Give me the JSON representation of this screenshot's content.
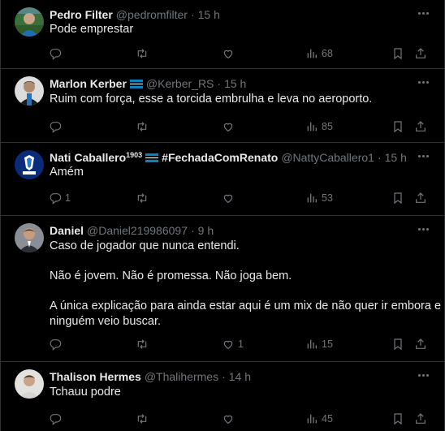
{
  "tweets": [
    {
      "name": "Pedro Filter",
      "name_sup": "",
      "hashtag": "",
      "handle": "@pedromfilter",
      "time": "15 h",
      "text": [
        "Pode emprestar"
      ],
      "replies": "",
      "retweets": "",
      "likes": "",
      "views": "68",
      "avatar": "pedro-avatar"
    },
    {
      "name": "Marlon Kerber",
      "name_sup": "",
      "hashtag": "",
      "handle": "@Kerber_RS",
      "time": "15 h",
      "text": [
        "Ruim com força, esse a torcida embrulha e leva no aeroporto."
      ],
      "replies": "",
      "retweets": "",
      "likes": "",
      "views": "85",
      "avatar": "marlon-avatar"
    },
    {
      "name": "Nati Caballero",
      "name_sup": "1903",
      "hashtag": "#FechadaComRenato",
      "handle": "@NattyCaballero1",
      "time": "15 h",
      "text": [
        "Amém"
      ],
      "replies": "1",
      "retweets": "",
      "likes": "",
      "views": "53",
      "avatar": "gremio-crest-avatar"
    },
    {
      "name": "Daniel",
      "name_sup": "",
      "hashtag": "",
      "handle": "@Daniel219986097",
      "time": "9 h",
      "text": [
        "Caso de jogador que nunca entendi.",
        "",
        "Não é jovem. Não é promessa. Não joga bem.",
        "",
        "A única explicação para ainda estar aqui é um mix de não quer ir embora e",
        "ninguém veio buscar."
      ],
      "replies": "",
      "retweets": "",
      "likes": "1",
      "views": "15",
      "avatar": "daniel-avatar"
    },
    {
      "name": "Thalison Hermes",
      "name_sup": "",
      "hashtag": "",
      "handle": "@Thalihermes",
      "time": "14 h",
      "text": [
        "Tchauu podre"
      ],
      "replies": "",
      "retweets": "",
      "likes": "",
      "views": "45",
      "avatar": "thalison-avatar"
    }
  ],
  "dot_separator": "·",
  "icons": {
    "reply": "reply-icon",
    "retweet": "retweet-icon",
    "like": "like-icon",
    "views": "views-icon",
    "bookmark": "bookmark-icon",
    "share": "share-icon",
    "more": "more-icon",
    "flag": "gremio-flag-icon"
  },
  "colors": {
    "background": "#000000",
    "text": "#e7e9ea",
    "muted": "#71767b",
    "border": "#2f3336"
  }
}
